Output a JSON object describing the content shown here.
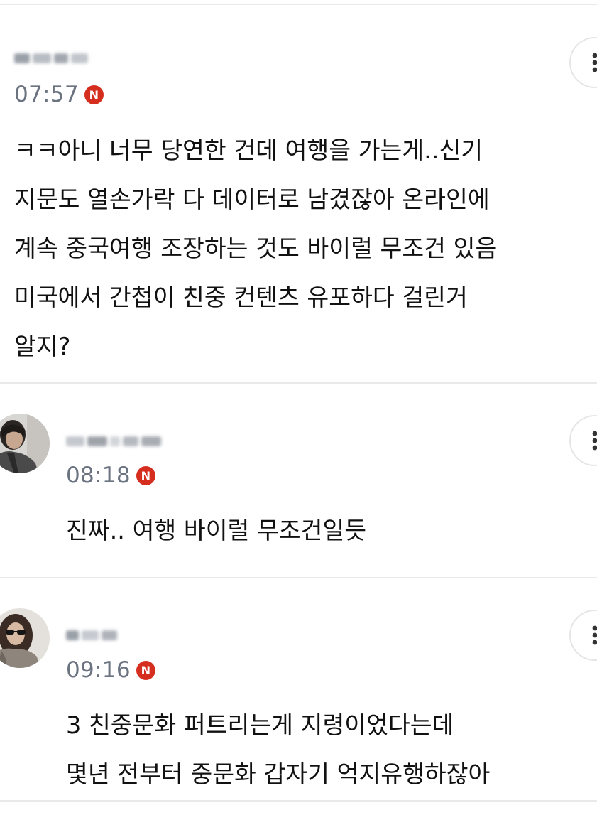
{
  "colors": {
    "background": "#ffffff",
    "divider": "#e9e9e9",
    "timestamp": "#6b7280",
    "badge": "#d52e1f",
    "badge_text": "#ffffff",
    "text": "#111111"
  },
  "icons": {
    "more": "more-vertical-icon",
    "badge": "n-badge-icon"
  },
  "comments": [
    {
      "username": "",
      "time": "07:57",
      "badge": "N",
      "body": [
        "ㅋㅋ아니 너무 당연한 건데 여행을 가는게..신기",
        "지문도 열손가락 다 데이터로 남겼잖아 온라인에",
        "계속 중국여행 조장하는 것도 바이럴 무조건 있음",
        "미국에서 간첩이 친중 컨텐츠 유포하다 걸린거",
        "알지?"
      ]
    },
    {
      "username": "",
      "time": "08:18",
      "badge": "N",
      "body": [
        "진짜.. 여행 바이럴 무조건일듯"
      ]
    },
    {
      "username": "",
      "time": "09:16",
      "badge": "N",
      "body": [
        "3 친중문화 퍼트리는게 지령이었다는데",
        "몇년 전부터 중문화 갑자기 억지유행하잖아"
      ]
    }
  ]
}
